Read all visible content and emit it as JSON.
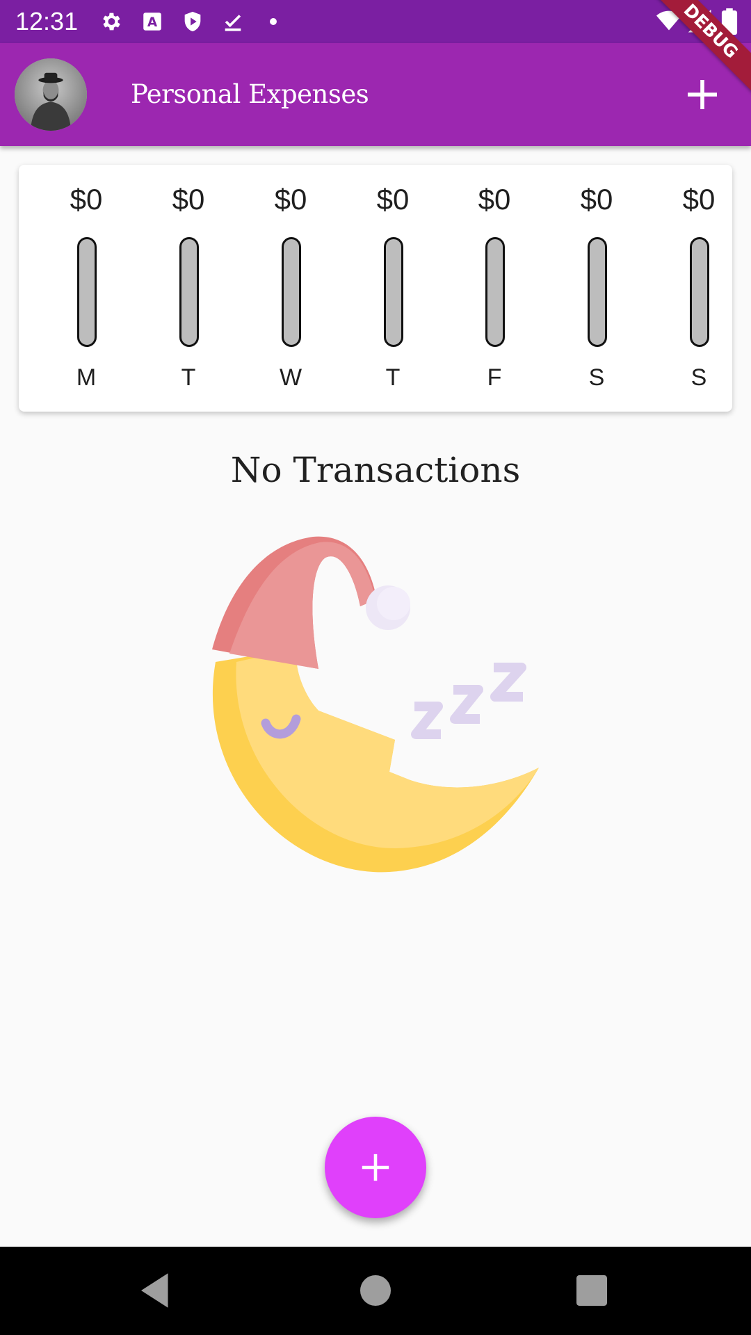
{
  "status_bar": {
    "time": "12:31",
    "icons": [
      "settings-icon",
      "a-badge-icon",
      "shield-play-icon",
      "download-done-icon",
      "dot-icon",
      "wifi-icon",
      "signal-icon",
      "battery-icon"
    ]
  },
  "debug_banner": "DEBUG",
  "app_bar": {
    "title": "Personal Expenses",
    "avatar": "avatar-photo",
    "action_icon": "add-icon"
  },
  "chart_data": {
    "type": "bar",
    "categories": [
      "M",
      "T",
      "W",
      "T",
      "F",
      "S",
      "S"
    ],
    "values": [
      0,
      0,
      0,
      0,
      0,
      0,
      0
    ],
    "labels": [
      "$0",
      "$0",
      "$0",
      "$0",
      "$0",
      "$0",
      "$0"
    ],
    "fill_fraction": [
      0,
      0,
      0,
      0,
      0,
      0,
      0
    ],
    "track_color": "#bdbdbd",
    "fill_color": "#9c27b0"
  },
  "empty_state": {
    "title": "No Transactions",
    "image": "sleeping-moon-illustration"
  },
  "fab": {
    "icon": "add-icon",
    "color": "#e040fb"
  },
  "nav_bar": {
    "buttons": [
      "back-icon",
      "home-icon",
      "recents-icon"
    ]
  },
  "colors": {
    "status_bar": "#7b1fa2",
    "app_bar": "#9c27b0",
    "background": "#fafafa",
    "debug_banner": "#a31c3a"
  }
}
